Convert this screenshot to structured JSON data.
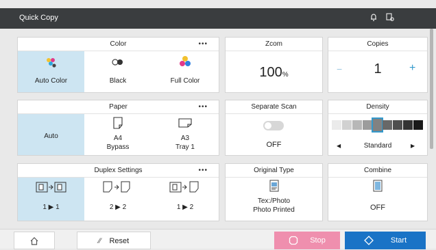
{
  "app": {
    "title": "Quick Copy"
  },
  "header_icons": [
    "bell-icon",
    "device-settings-icon"
  ],
  "color": {
    "title": "Color",
    "more": "•••",
    "options": [
      {
        "label": "Auto Color",
        "selected": true
      },
      {
        "label": "Black",
        "selected": false
      },
      {
        "label": "Full Color",
        "selected": false
      }
    ]
  },
  "zoom": {
    "title": "Zcom",
    "value": "100",
    "unit": "%"
  },
  "copies": {
    "title": "Copies",
    "value": "1",
    "minus": "−",
    "plus": "+"
  },
  "paper": {
    "title": "Paper",
    "more": "•••",
    "options": [
      {
        "line1": "Auto",
        "line2": "",
        "selected": true
      },
      {
        "line1": "A4",
        "line2": "Bypass",
        "selected": false
      },
      {
        "line1": "A3",
        "line2": "Tray 1",
        "selected": false
      }
    ]
  },
  "separate_scan": {
    "title": "Separate Scan",
    "value": "OFF"
  },
  "density": {
    "title": "Density",
    "value": "Standard",
    "left": "◀",
    "right": "▶",
    "level": 5,
    "levels": 9
  },
  "duplex": {
    "title": "Duplex Settings",
    "more": "•••",
    "options": [
      {
        "left": "1",
        "right": "1",
        "selected": true
      },
      {
        "left": "2",
        "right": "2",
        "selected": false
      },
      {
        "left": "1",
        "right": "2",
        "selected": false
      }
    ]
  },
  "original_type": {
    "title": "Original Type",
    "line1": "Tex:/Photo",
    "line2": "Photo Printed"
  },
  "combine": {
    "title": "Combine",
    "value": "OFF"
  },
  "footer": {
    "reset": "Reset",
    "stop": "Stop",
    "start": "Start"
  },
  "colors": {
    "selected_bg": "#cde5f2",
    "header_bg": "#3a3d3f",
    "stop_bg": "#ef8fae",
    "start_bg": "#1a73c6",
    "accent_blue": "#3399cc"
  }
}
